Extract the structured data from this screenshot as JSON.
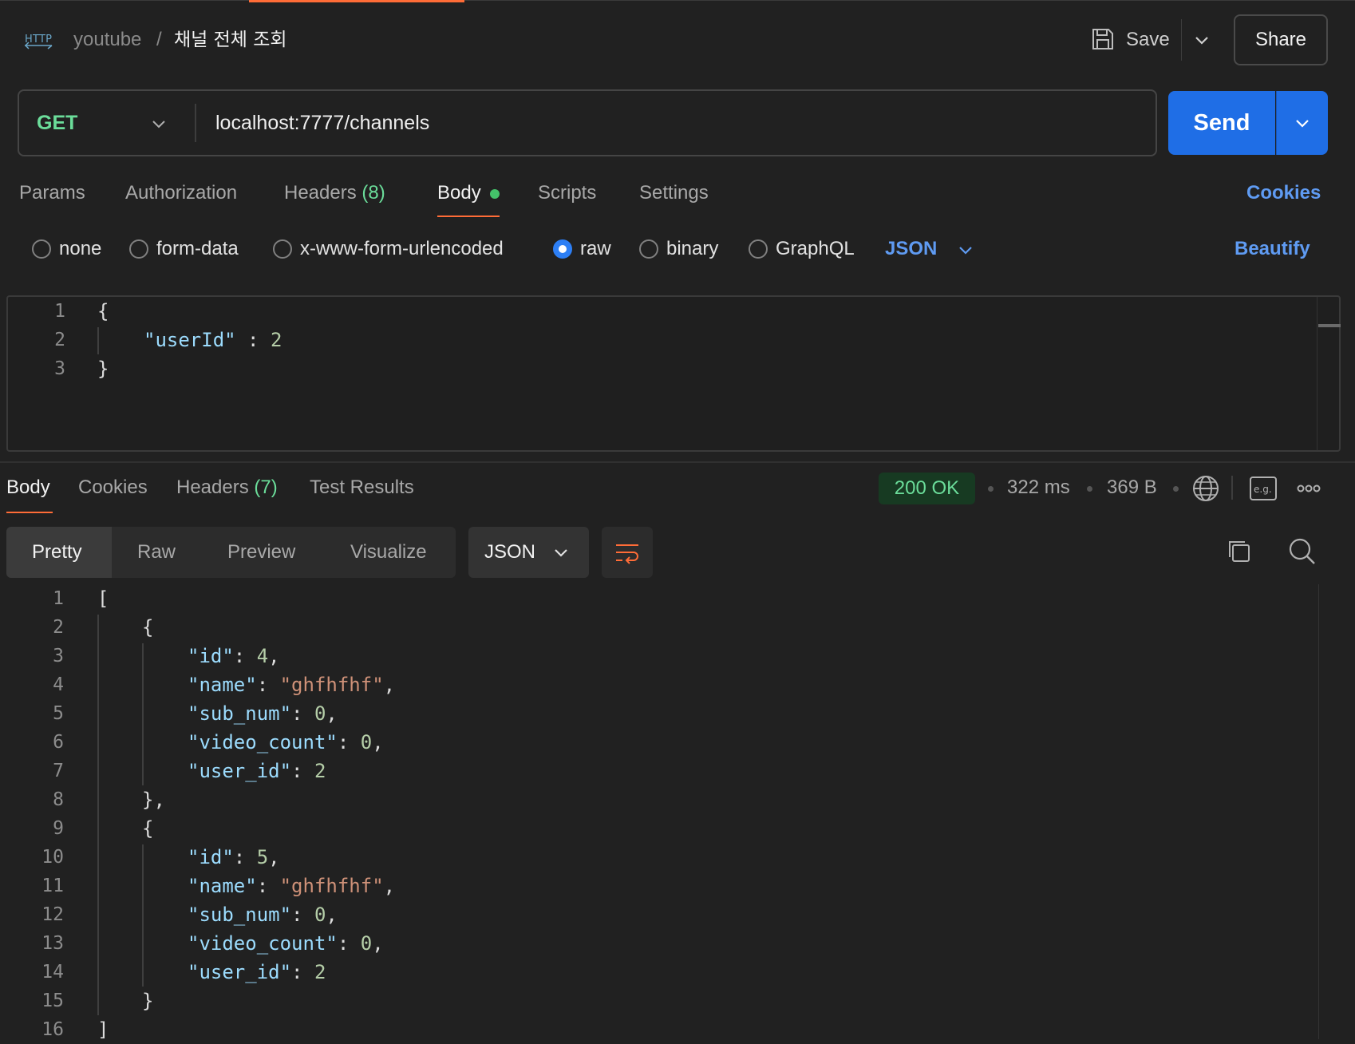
{
  "header": {
    "icon": "http-icon",
    "collection": "youtube",
    "separator": "/",
    "request_name": "채널 전체 조회",
    "save_label": "Save",
    "share_label": "Share"
  },
  "request": {
    "method": "GET",
    "url": "localhost:7777/channels",
    "send_label": "Send"
  },
  "request_tabs": {
    "params": "Params",
    "authorization": "Authorization",
    "headers": "Headers",
    "headers_count": "(8)",
    "body": "Body",
    "scripts": "Scripts",
    "settings": "Settings",
    "cookies": "Cookies",
    "active": "Body"
  },
  "body_types": {
    "none": "none",
    "form_data": "form-data",
    "urlencoded": "x-www-form-urlencoded",
    "raw": "raw",
    "binary": "binary",
    "graphql": "GraphQL",
    "selected": "raw",
    "raw_format": "JSON",
    "beautify": "Beautify"
  },
  "request_body": {
    "line_numbers": [
      "1",
      "2",
      "3"
    ],
    "open_brace": "{",
    "key": "\"userId\"",
    "colon": " : ",
    "value": "2",
    "close_brace": "}"
  },
  "response_tabs": {
    "body": "Body",
    "cookies": "Cookies",
    "headers": "Headers",
    "headers_count": "(7)",
    "test_results": "Test Results",
    "active": "Body"
  },
  "response_meta": {
    "status": "200 OK",
    "time": "322 ms",
    "size": "369 B",
    "status_color": "#6bdd9a"
  },
  "response_view": {
    "pretty": "Pretty",
    "raw": "Raw",
    "preview": "Preview",
    "visualize": "Visualize",
    "format": "JSON",
    "active": "Pretty"
  },
  "response_body": {
    "line_numbers": [
      "1",
      "2",
      "3",
      "4",
      "5",
      "6",
      "7",
      "8",
      "9",
      "10",
      "11",
      "12",
      "13",
      "14",
      "15",
      "16"
    ],
    "open_bracket": "[",
    "close_bracket": "]",
    "open_brace": "{",
    "close_brace_comma": "},",
    "close_brace": "}",
    "items": [
      {
        "id": "4",
        "name": "\"ghfhfhf\"",
        "sub_num": "0",
        "video_count": "0",
        "user_id": "2"
      },
      {
        "id": "5",
        "name": "\"ghfhfhf\"",
        "sub_num": "0",
        "video_count": "0",
        "user_id": "2"
      }
    ],
    "keys": {
      "id": "\"id\"",
      "name": "\"name\"",
      "sub_num": "\"sub_num\"",
      "video_count": "\"video_count\"",
      "user_id": "\"user_id\""
    }
  },
  "colors": {
    "accent": "#ff6c37",
    "send": "#1f6ee6",
    "link": "#5f9bf2",
    "json_key": "#9cdcfe",
    "json_number": "#b5cea8",
    "json_string": "#ce9178"
  }
}
